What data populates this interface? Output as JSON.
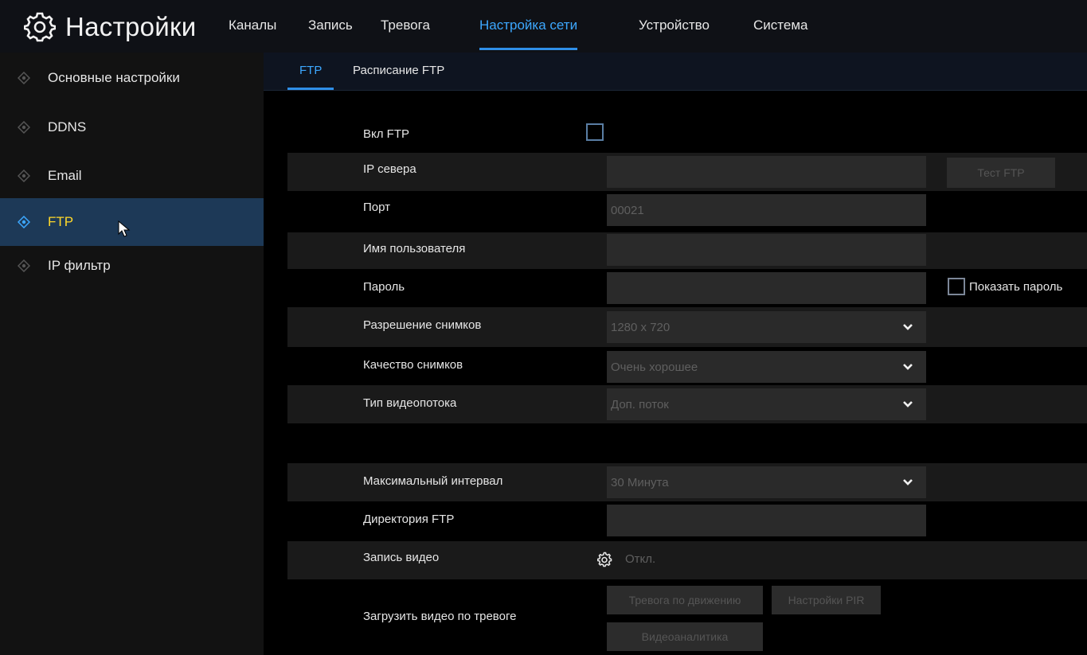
{
  "header": {
    "title": "Настройки",
    "icon": "gear-icon",
    "tabs": [
      {
        "label": "Каналы",
        "active": false
      },
      {
        "label": "Запись",
        "active": false
      },
      {
        "label": "Тревога",
        "active": false
      },
      {
        "label": "Настройка сети",
        "active": true
      },
      {
        "label": "Устройство",
        "active": false
      },
      {
        "label": "Система",
        "active": false
      }
    ]
  },
  "sidebar": {
    "items": [
      {
        "label": "Основные настройки",
        "active": false
      },
      {
        "label": "DDNS",
        "active": false
      },
      {
        "label": "Email",
        "active": false
      },
      {
        "label": "FTP",
        "active": true
      },
      {
        "label": "IP фильтр",
        "active": false
      }
    ]
  },
  "subtabs": [
    {
      "label": "FTP",
      "active": true
    },
    {
      "label": "Расписание FTP",
      "active": false
    }
  ],
  "form": {
    "enable_ftp": {
      "label": "Вкл FTP",
      "checked": false
    },
    "server_ip": {
      "label": "IP севера",
      "value": ""
    },
    "test_ftp_button": "Тест FTP",
    "port": {
      "label": "Порт",
      "value": "00021"
    },
    "username": {
      "label": "Имя пользователя",
      "value": ""
    },
    "password": {
      "label": "Пароль",
      "value": ""
    },
    "show_password": {
      "label": "Показать пароль",
      "checked": false
    },
    "snapshot_resolution": {
      "label": "Разрешение снимков",
      "value": "1280 x 720"
    },
    "snapshot_quality": {
      "label": "Качество снимков",
      "value": "Очень хорошее"
    },
    "stream_type": {
      "label": "Тип видеопотока",
      "value": "Доп. поток"
    },
    "max_interval": {
      "label": "Максимальный интервал",
      "value": "30 Минута"
    },
    "ftp_directory": {
      "label": "Директория FTP",
      "value": ""
    },
    "video_record": {
      "label": "Запись видео",
      "value": "Откл."
    },
    "alarm_upload": {
      "label": "Загрузить видео по тревоге",
      "buttons": [
        "Тревога по движению",
        "Настройки PIR",
        "Видеоаналитика"
      ]
    }
  },
  "colors": {
    "accent": "#3da8ff",
    "active_sidebar_bg": "#1d3957",
    "active_sidebar_text": "#ffd82a"
  }
}
